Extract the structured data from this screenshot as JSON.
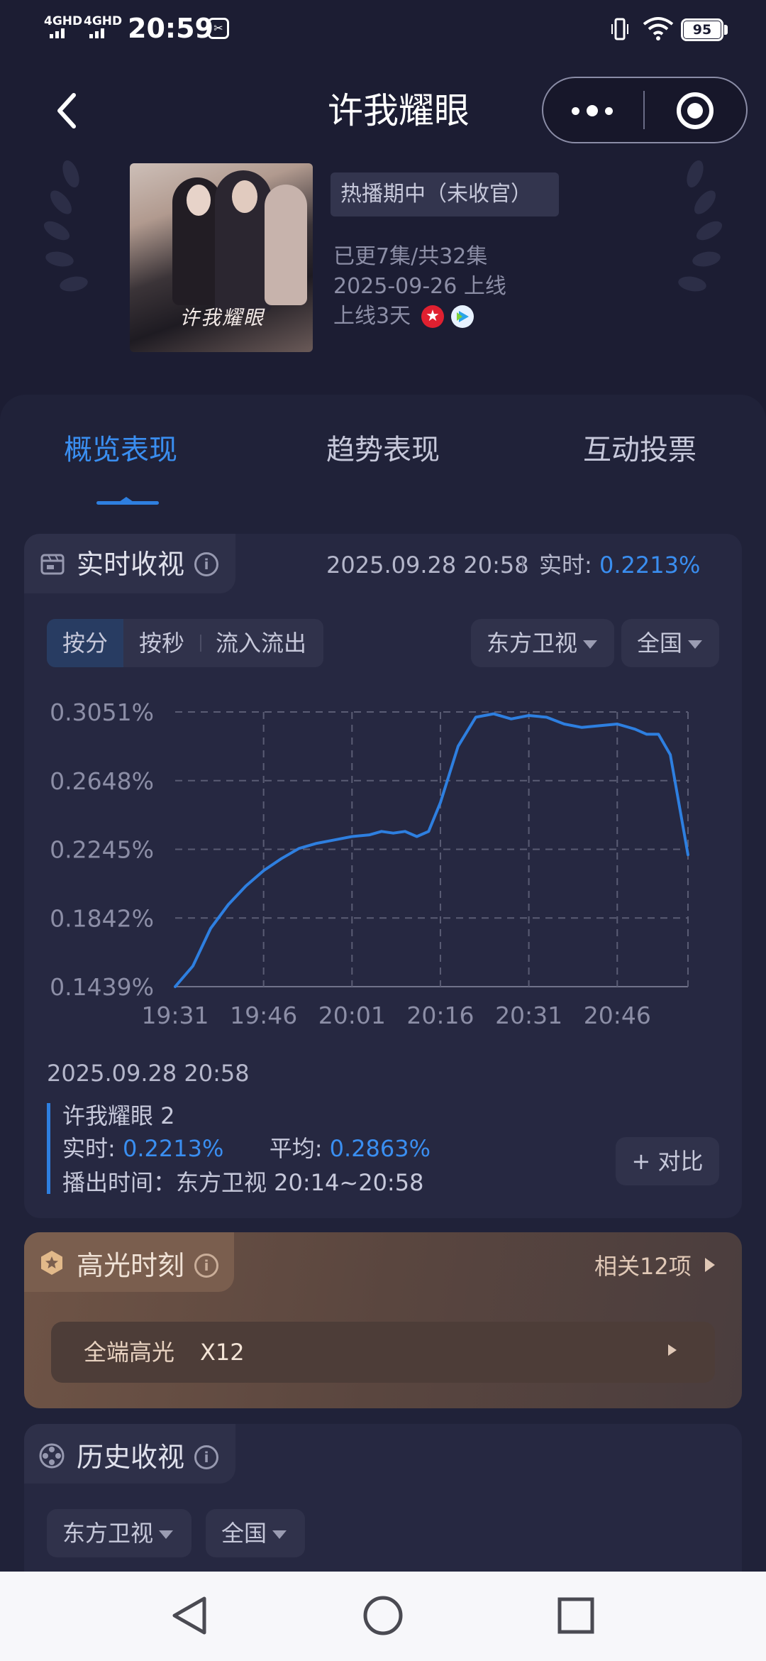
{
  "status_bar": {
    "network_1": "4GHD",
    "network_2": "4GHD",
    "time": "20:59",
    "battery": "95"
  },
  "nav": {
    "title": "许我耀眼",
    "icons": [
      "back-icon",
      "more-dots-icon",
      "target-icon"
    ]
  },
  "show": {
    "poster_text": "许我耀眼",
    "status_tag": "热播期中（未收官）",
    "episodes": "已更7集/共32集",
    "release_date": "2025-09-26 上线",
    "days_online": "上线3天",
    "platform_icons": [
      "dragon-tv-star-icon",
      "tencent-video-play-icon"
    ]
  },
  "tabs": [
    {
      "label": "概览表现",
      "active": true
    },
    {
      "label": "趋势表现",
      "active": false
    },
    {
      "label": "互动投票",
      "active": false
    }
  ],
  "realtime": {
    "title": "实时收视",
    "timestamp": "2025.09.28 20:58",
    "realtime_label": "实时:",
    "realtime_value": "0.2213%",
    "segments": [
      "按分",
      "按秒",
      "流入流出"
    ],
    "selected_segment": "按分",
    "channel": "东方卫视",
    "region": "全国"
  },
  "chart_data": {
    "type": "line",
    "y_tick_labels": [
      "0.3051%",
      "0.2648%",
      "0.2245%",
      "0.1842%",
      "0.1439%"
    ],
    "x_tick_labels": [
      "19:31",
      "19:46",
      "20:01",
      "20:16",
      "20:31",
      "20:46"
    ],
    "ylim": [
      0.1439,
      0.3051
    ],
    "x_minutes_range": [
      "19:31",
      "20:58"
    ],
    "series_color": "#2e7fe0",
    "grid": true,
    "series": [
      {
        "x": [
          "19:31",
          "19:34",
          "19:37",
          "19:40",
          "19:43",
          "19:46",
          "19:49",
          "19:52",
          "19:55",
          "19:58",
          "20:01",
          "20:04",
          "20:06",
          "20:08",
          "20:10",
          "20:12",
          "20:14",
          "20:16",
          "20:19",
          "20:22",
          "20:25",
          "20:28",
          "20:31",
          "20:34",
          "20:37",
          "20:40",
          "20:43",
          "20:46",
          "20:49",
          "20:51",
          "20:53",
          "20:55",
          "20:58"
        ],
        "values": [
          0.1439,
          0.156,
          0.178,
          0.192,
          0.203,
          0.212,
          0.219,
          0.225,
          0.228,
          0.23,
          0.232,
          0.233,
          0.235,
          0.234,
          0.235,
          0.232,
          0.235,
          0.252,
          0.285,
          0.302,
          0.304,
          0.301,
          0.303,
          0.302,
          0.298,
          0.296,
          0.297,
          0.298,
          0.295,
          0.292,
          0.292,
          0.28,
          0.2213
        ]
      }
    ]
  },
  "summary": {
    "timestamp": "2025.09.28 20:58",
    "episode": "许我耀眼 2",
    "realtime_label": "实时:",
    "realtime_value": "0.2213%",
    "average_label": "平均:",
    "average_value": "0.2863%",
    "airtime": "播出时间：东方卫视 20:14~20:58",
    "compare_button": "+ 对比"
  },
  "highlights": {
    "title": "高光时刻",
    "related": "相关12项",
    "row_label": "全端高光",
    "row_value": "X12"
  },
  "history": {
    "title": "历史收视",
    "channel": "东方卫视",
    "region": "全国"
  },
  "system_nav": [
    "back-triangle-icon",
    "home-circle-icon",
    "recents-square-icon"
  ]
}
